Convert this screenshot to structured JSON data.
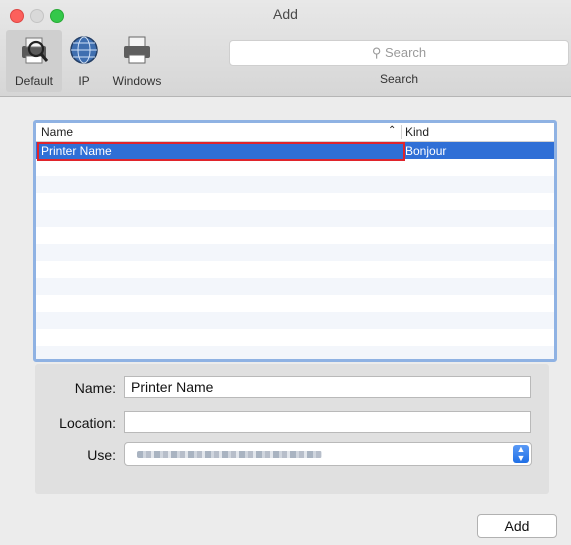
{
  "window": {
    "title": "Add"
  },
  "toolbar": {
    "items": [
      {
        "label": "Default",
        "icon": "default-printer-icon",
        "selected": true
      },
      {
        "label": "IP",
        "icon": "globe-icon",
        "selected": false
      },
      {
        "label": "Windows",
        "icon": "printer-icon",
        "selected": false
      }
    ],
    "search_placeholder": "Search",
    "search_label": "Search"
  },
  "list": {
    "columns": {
      "name": "Name",
      "kind": "Kind"
    },
    "rows": [
      {
        "name": "Printer Name",
        "kind": "Bonjour",
        "selected": true
      }
    ]
  },
  "form": {
    "name_label": "Name:",
    "name_value": "Printer Name",
    "location_label": "Location:",
    "location_value": "",
    "use_label": "Use:"
  },
  "buttons": {
    "add": "Add"
  },
  "colors": {
    "selection": "#2f6fd6",
    "highlight_border": "#e0242b",
    "list_border": "#8fb2e3"
  }
}
